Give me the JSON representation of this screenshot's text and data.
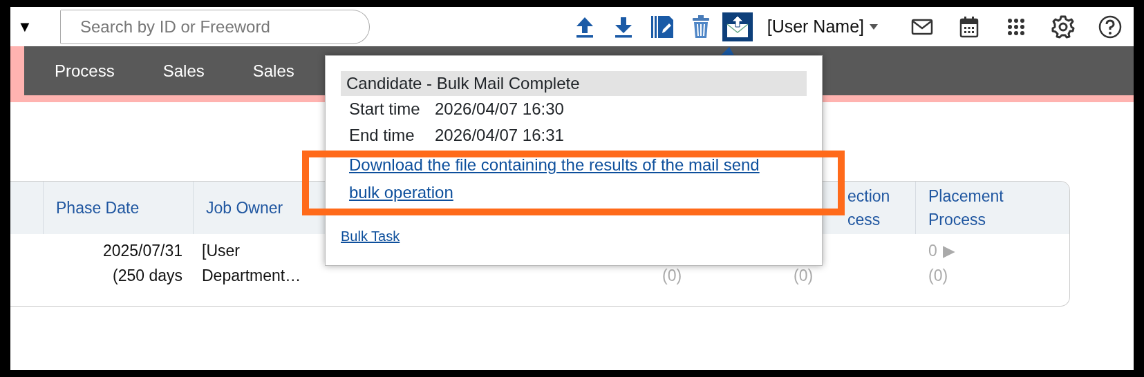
{
  "search": {
    "scope_toggle": "▼",
    "placeholder": "Search by ID or Freeword"
  },
  "toolbar": {
    "actions": [
      {
        "kind": "upload",
        "selected": false
      },
      {
        "kind": "download",
        "selected": false
      },
      {
        "kind": "notebook",
        "selected": false
      },
      {
        "kind": "trash",
        "selected": false
      },
      {
        "kind": "mail-export",
        "selected": true
      }
    ],
    "user_name": "[User Name]",
    "utilities": [
      {
        "kind": "mail"
      },
      {
        "kind": "calendar"
      },
      {
        "kind": "apps"
      },
      {
        "kind": "settings"
      },
      {
        "kind": "help"
      }
    ]
  },
  "nav": {
    "items": [
      "Process",
      "Sales",
      "Sales"
    ]
  },
  "table": {
    "columns": [
      "",
      "Phase Date",
      "Job Owner",
      "",
      "",
      "",
      "ection cess",
      "Placement Process"
    ],
    "rows": [
      {
        "cells": [
          "",
          {
            "kind": "text",
            "lines": [
              "2025/07/31",
              "(250 days"
            ]
          },
          {
            "kind": "text",
            "lines": [
              "[User",
              "Department…"
            ]
          },
          "",
          "",
          {
            "kind": "count",
            "sub": "(0)"
          },
          {
            "kind": "count",
            "sub": "(0)"
          },
          {
            "kind": "count",
            "value": "0",
            "arrow": "▶",
            "sub": "(0)"
          }
        ]
      }
    ]
  },
  "popup": {
    "title": "Candidate - Bulk Mail Complete",
    "details": [
      {
        "label": "Start time",
        "value": "2026/04/07 16:30"
      },
      {
        "label": "End time",
        "value": "2026/04/07 16:31"
      }
    ],
    "link": "Download the file containing the results of the mail send bulk operation",
    "footer_link": "Bulk Task"
  }
}
